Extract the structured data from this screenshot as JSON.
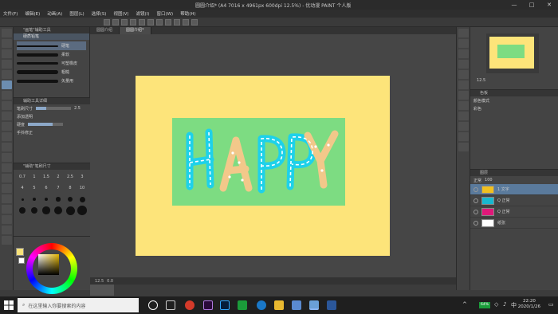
{
  "app": {
    "title": "圆圆介绍* (A4 7016 x 4961px 600dpi 12.5%) - 优动漫 PAINT 个人版",
    "window_controls": {
      "minimize": "—",
      "maximize": "□",
      "close": "✕"
    }
  },
  "menu": [
    "文件(F)",
    "编辑(E)",
    "动画(A)",
    "图层(L)",
    "选择(S)",
    "视图(V)",
    "滤镜(I)",
    "窗口(W)",
    "帮助(H)"
  ],
  "doc_tabs": [
    "圆圆介绍",
    "圆圆介绍*"
  ],
  "subtool": {
    "header": "\"画笔\"辅助工具",
    "group": "硬质铅笔",
    "brushes": [
      {
        "name": "硬笔"
      },
      {
        "name": "柔软"
      },
      {
        "name": "可塑橡皮"
      },
      {
        "name": "粗糙"
      },
      {
        "name": "矢量用"
      }
    ]
  },
  "tool_property": {
    "header": "辅助工具详细",
    "size_label": "笔刷尺寸",
    "size_value": "2.5",
    "blend_label": "添加透明",
    "opacity_label": "硬度",
    "misc_label": "手抖修正"
  },
  "brush_size": {
    "header": "\"辅助\"笔刷尺寸",
    "labels": [
      "0.7",
      "1",
      "1.5",
      "2",
      "2.5",
      "3",
      "4",
      "5",
      "6",
      "7",
      "8",
      "10",
      "12",
      "15",
      "17",
      "20",
      "25",
      "30",
      "40",
      "50",
      "60",
      "70",
      "80",
      "100"
    ]
  },
  "canvas_status": {
    "zoom": "12.5",
    "angle": "0.0"
  },
  "navigator": {
    "zoom": "12.5"
  },
  "color_set": {
    "header": "色板",
    "mode_label": "颜色模式",
    "mode_value": "彩色"
  },
  "layers": {
    "header": "图层",
    "mode": "正常",
    "opacity": "100",
    "items": [
      {
        "name": "1 文字",
        "color": "#f0c020"
      },
      {
        "name": "Q 正常",
        "color": "#18b8d0"
      },
      {
        "name": "Q 正常",
        "color": "#e0187a"
      },
      {
        "name": "纸张",
        "color": "#ffffff"
      }
    ]
  },
  "canvas": {
    "word": "HAPPY"
  },
  "taskbar": {
    "search_placeholder": "在这里输入你要搜索的内容",
    "time": "22:20",
    "date": "2020/1/26",
    "battery": "64%",
    "ime": "中"
  }
}
